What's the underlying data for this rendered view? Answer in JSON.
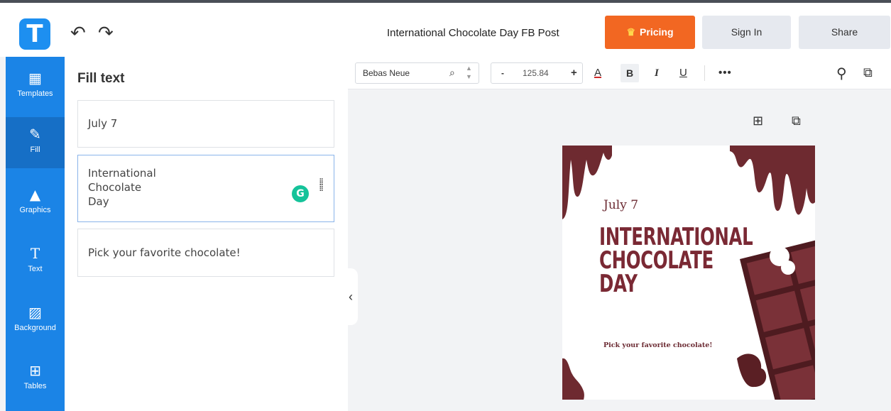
{
  "header": {
    "logo_letter": "T",
    "undo_icon": "undo-icon",
    "redo_icon": "redo-icon",
    "document_title": "International Chocolate Day FB Post",
    "pricing_label": "Pricing",
    "signin_label": "Sign In",
    "share_label": "Share"
  },
  "sidebar": {
    "items": [
      {
        "label": "Templates",
        "icon": "templates-icon"
      },
      {
        "label": "Fill",
        "icon": "pencil-icon"
      },
      {
        "label": "Graphics",
        "icon": "shapes-icon"
      },
      {
        "label": "Text",
        "icon": "text-icon"
      },
      {
        "label": "Background",
        "icon": "background-icon"
      },
      {
        "label": "Tables",
        "icon": "table-icon"
      }
    ],
    "active": "Fill"
  },
  "panel": {
    "title": "Fill text",
    "fields": [
      {
        "lines": [
          "July 7"
        ]
      },
      {
        "lines": [
          "International",
          "Chocolate",
          "Day"
        ]
      },
      {
        "lines": [
          "Pick your favorite chocolate!"
        ]
      }
    ],
    "grammarly_letter": "G"
  },
  "toolbar": {
    "font_family": "Bebas Neue",
    "font_size": "125.84",
    "minus": "-",
    "plus": "+",
    "color_glyph": "A",
    "bold_glyph": "B",
    "italic_glyph": "I",
    "underline_glyph": "U",
    "more_glyph": "•••"
  },
  "canvas": {
    "date": "July 7",
    "title_lines": [
      "INTERNATIONAL",
      "CHOCOLATE",
      "DAY"
    ],
    "subtitle": "Pick your favorite chocolate!",
    "colors": {
      "chocolate": "#6e2a30",
      "title": "#7a2934",
      "bar": "#5a1f24"
    }
  },
  "colors": {
    "accent_blue": "#1b84e6",
    "pricing_orange": "#f26722"
  }
}
